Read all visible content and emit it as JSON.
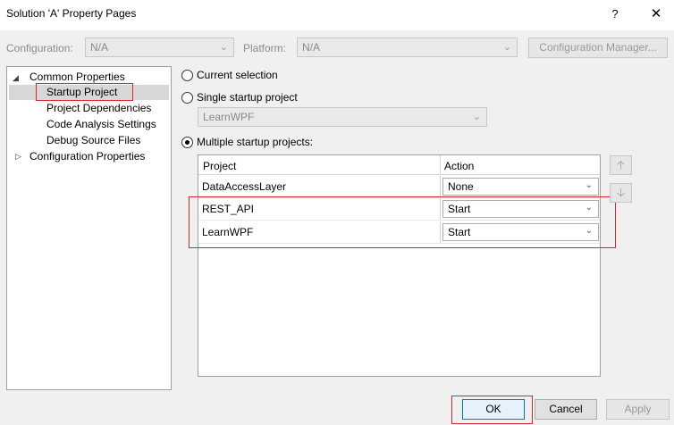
{
  "window": {
    "title": "Solution 'A' Property Pages",
    "help_label": "?",
    "close_label": "✕"
  },
  "topbar": {
    "configuration_label": "Configuration:",
    "configuration_value": "N/A",
    "platform_label": "Platform:",
    "platform_value": "N/A",
    "config_manager_label": "Configuration Manager..."
  },
  "tree": {
    "common_properties": "Common Properties",
    "items": [
      {
        "label": "Startup Project",
        "selected": true
      },
      {
        "label": "Project Dependencies"
      },
      {
        "label": "Code Analysis Settings"
      },
      {
        "label": "Debug Source Files"
      }
    ],
    "configuration_properties": "Configuration Properties"
  },
  "options": {
    "current_selection": "Current selection",
    "single_startup": "Single startup project",
    "single_startup_value": "LearnWPF",
    "multiple_startup": "Multiple startup projects:",
    "selected": "multiple"
  },
  "grid": {
    "headers": {
      "project": "Project",
      "action": "Action"
    },
    "rows": [
      {
        "project": "DataAccessLayer",
        "action": "None"
      },
      {
        "project": "REST_API",
        "action": "Start"
      },
      {
        "project": "LearnWPF",
        "action": "Start"
      }
    ]
  },
  "footer": {
    "ok_label": "OK",
    "cancel_label": "Cancel",
    "apply_label": "Apply"
  },
  "colors": {
    "highlight_box": "#e0242b",
    "selection": "#d7d7d7"
  }
}
